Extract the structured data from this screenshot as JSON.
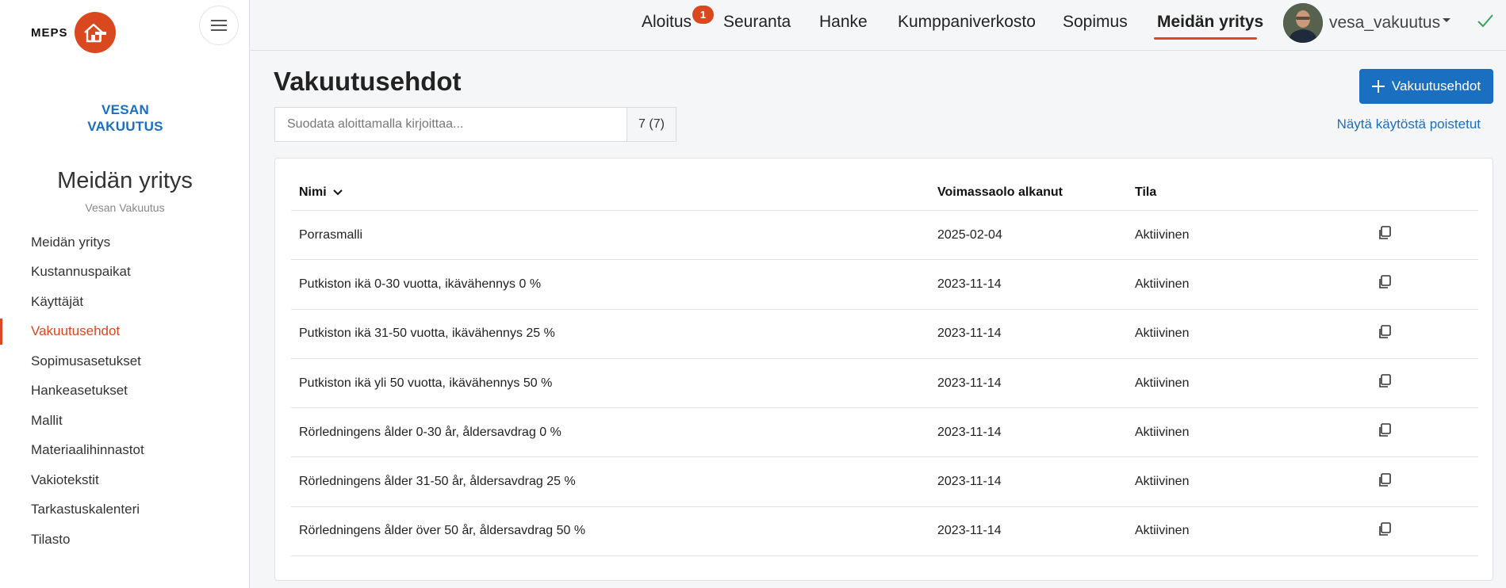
{
  "brand": {
    "name": "MEPS",
    "accent": "#d9481f",
    "primary": "#1a6fc1"
  },
  "sidebar": {
    "company_logo_line1": "VESAN",
    "company_logo_line2": "VAKUUTUS",
    "title": "Meidän yritys",
    "subtitle": "Vesan Vakuutus",
    "items": [
      {
        "label": "Meidän yritys"
      },
      {
        "label": "Kustannuspaikat"
      },
      {
        "label": "Käyttäjät"
      },
      {
        "label": "Vakuutusehdot",
        "active": true
      },
      {
        "label": "Sopimusasetukset"
      },
      {
        "label": "Hankeasetukset"
      },
      {
        "label": "Mallit"
      },
      {
        "label": "Materiaalihinnastot"
      },
      {
        "label": "Vakiotekstit"
      },
      {
        "label": "Tarkastuskalenteri"
      },
      {
        "label": "Tilasto"
      }
    ]
  },
  "topnav": {
    "items": [
      {
        "label": "Aloitus",
        "badge": "1"
      },
      {
        "label": "Seuranta"
      },
      {
        "label": "Hanke"
      },
      {
        "label": "Kumppaniverkosto"
      },
      {
        "label": "Sopimus"
      },
      {
        "label": "Meidän yritys",
        "active": true
      }
    ],
    "username": "vesa_vakuutus"
  },
  "main": {
    "title": "Vakuutusehdot",
    "add_button": "Vakuutusehdot",
    "filter_placeholder": "Suodata aloittamalla kirjoittaa...",
    "count": "7 (7)",
    "show_removed": "Näytä käytöstä poistetut",
    "table": {
      "headers": {
        "name": "Nimi",
        "date": "Voimassaolo alkanut",
        "state": "Tila"
      },
      "rows": [
        {
          "name": "Porrasmalli",
          "date": "2025-02-04",
          "state": "Aktiivinen"
        },
        {
          "name": "Putkiston ikä 0-30 vuotta, ikävähennys 0 %",
          "date": "2023-11-14",
          "state": "Aktiivinen"
        },
        {
          "name": "Putkiston ikä 31-50 vuotta, ikävähennys 25 %",
          "date": "2023-11-14",
          "state": "Aktiivinen"
        },
        {
          "name": "Putkiston ikä yli 50 vuotta, ikävähennys 50 %",
          "date": "2023-11-14",
          "state": "Aktiivinen"
        },
        {
          "name": "Rörledningens ålder 0-30 år, åldersavdrag 0 %",
          "date": "2023-11-14",
          "state": "Aktiivinen"
        },
        {
          "name": "Rörledningens ålder 31-50 år, åldersavdrag 25 %",
          "date": "2023-11-14",
          "state": "Aktiivinen"
        },
        {
          "name": "Rörledningens ålder över 50 år, åldersavdrag 50 %",
          "date": "2023-11-14",
          "state": "Aktiivinen"
        }
      ]
    }
  }
}
